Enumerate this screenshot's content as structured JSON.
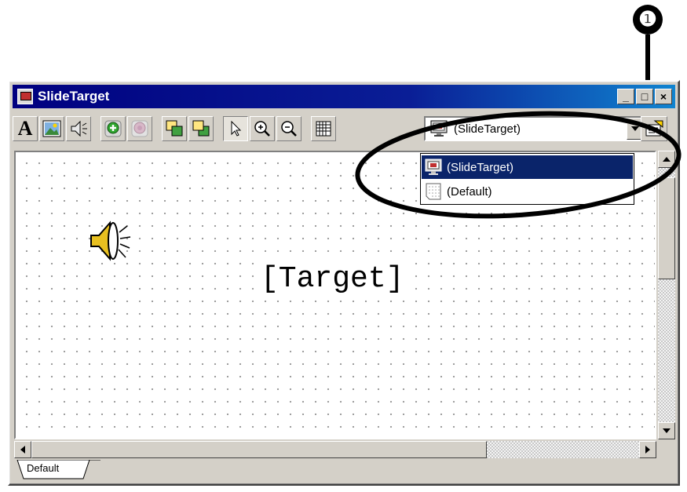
{
  "callout": {
    "number": "❶"
  },
  "window": {
    "title": "SlideTarget",
    "controls": {
      "minimize": "_",
      "maximize": "□",
      "close": "×"
    }
  },
  "toolbar": {
    "text_tool": "A",
    "buttons": [
      "text-tool",
      "image-tool",
      "sound-tool",
      "add-target",
      "remove-target",
      "bring-forward",
      "send-backward",
      "select-tool",
      "zoom-in",
      "zoom-out",
      "grid-toggle"
    ],
    "combo_value": "(SlideTarget)"
  },
  "dropdown": {
    "options": [
      {
        "label": "(SlideTarget)",
        "selected": true
      },
      {
        "label": "(Default)",
        "selected": false
      }
    ]
  },
  "canvas": {
    "target_label": "[Target]"
  },
  "tabs": [
    {
      "label": "Default"
    }
  ],
  "colors": {
    "title_bar": "#000080",
    "selection": "#0a246a",
    "face": "#d4d0c8"
  }
}
